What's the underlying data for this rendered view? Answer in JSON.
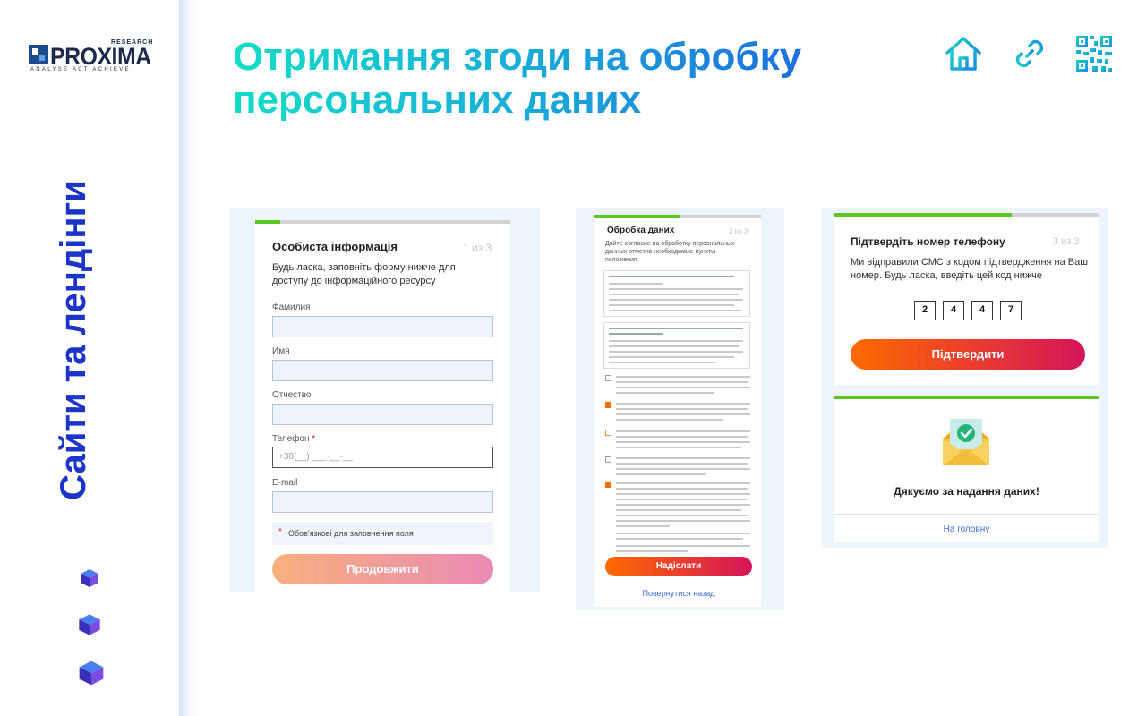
{
  "logo": {
    "research": "RESEARCH",
    "name": "PROXIMA",
    "tagline": "ANALYSE ACT ACHIEVE"
  },
  "sidebar": {
    "section_title": "Сайти та лендінги"
  },
  "header": {
    "title": "Отримання згоди на обробку персональних даних"
  },
  "top_icons": [
    "home-icon",
    "link-icon",
    "qr-code-icon"
  ],
  "colors": {
    "accent_blue": "#1a35c8",
    "progress_green": "#5cc722",
    "button_from": "#ff6a00",
    "button_to": "#d4145a"
  },
  "screen1": {
    "title": "Особиста інформація",
    "step": "1 из 3",
    "intro": "Будь ласка, заповніть форму нижче для доступу до інформаційного ресурсу",
    "fields": [
      {
        "label": "Фамилия",
        "placeholder": ""
      },
      {
        "label": "Имя",
        "placeholder": ""
      },
      {
        "label": "Отчество",
        "placeholder": ""
      },
      {
        "label": "Телефон",
        "required": "*",
        "placeholder": "+38(__) ___-__-__"
      },
      {
        "label": "E-mail",
        "placeholder": ""
      }
    ],
    "required_note_star": "*",
    "required_note": "Обов'язкові для заповнення поля",
    "continue_button": "Продовжити"
  },
  "screen2": {
    "title": "Обробка даних",
    "step": "2 из 3",
    "intro": "Дайте согласие на обработку персональных данных отметив необходимые пункты положения",
    "submit_button": "Надіслати",
    "back_link": "Повернутися назад"
  },
  "screen3": {
    "title": "Підтвердіть номер телефону",
    "step": "3 из 3",
    "message": "Ми відправили СМС з кодом підтвердження на Ваш номер. Будь ласка, введіть цей код нижче",
    "code_digits": [
      "2",
      "4",
      "4",
      "7"
    ],
    "confirm_button": "Підтвердити"
  },
  "screen4": {
    "thanks": "Дякуємо за надання даних!",
    "home_link": "На головну"
  }
}
